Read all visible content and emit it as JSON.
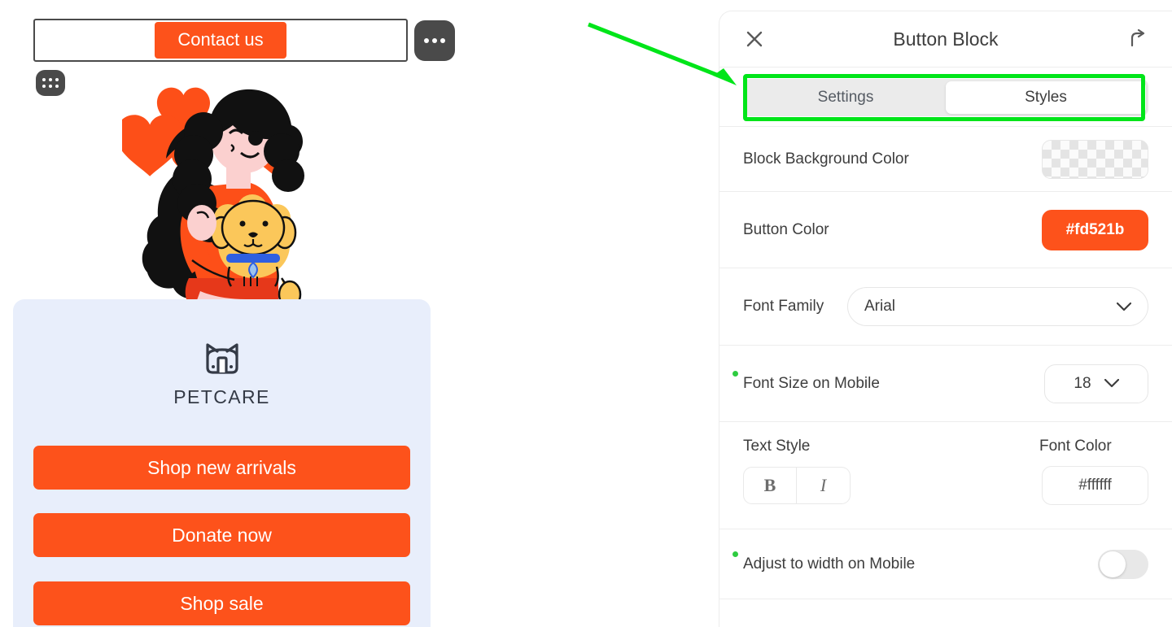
{
  "canvas": {
    "selected_block": {
      "cta_label": "Contact us",
      "more_icon": "ellipsis-icon",
      "drag_icon": "drag-grid-icon"
    },
    "illustration": {
      "alt": "woman holding a dog with hearts",
      "hair_color": "#111111",
      "shirt_color": "#fd4f18",
      "skin_color": "#fbd0cf",
      "dog_color": "#fbc75a",
      "heart_color": "#fd4f18",
      "collar_color": "#2f5fe0"
    },
    "pet_card": {
      "background": "#e8eefb",
      "logo_icon": "cat-face-icon",
      "logo_text": "PETCARE",
      "buttons": [
        {
          "label": "Shop new arrivals"
        },
        {
          "label": "Donate now"
        },
        {
          "label": "Shop sale"
        }
      ],
      "button_color": "#fd521b"
    }
  },
  "panel": {
    "title": "Button Block",
    "close_icon": "close-icon",
    "expand_icon": "arrow-up-right-curve-icon",
    "tabs": [
      {
        "label": "Settings",
        "active": false
      },
      {
        "label": "Styles",
        "active": true
      }
    ],
    "rows": {
      "block_background": {
        "label": "Block Background Color",
        "value": "transparent"
      },
      "button_color": {
        "label": "Button Color",
        "value": "#fd521b"
      },
      "font_family": {
        "label": "Font Family",
        "value": "Arial",
        "chevron_icon": "chevron-down-icon"
      },
      "font_size_mobile": {
        "label": "Font Size on Mobile",
        "value": "18",
        "chevron_icon": "chevron-down-icon",
        "indicator": "mobile-override-dot"
      },
      "text_style": {
        "label": "Text Style",
        "bold_label": "B",
        "italic_label": "I",
        "bold_active": false,
        "italic_active": false
      },
      "font_color": {
        "label": "Font Color",
        "value": "#ffffff"
      },
      "adjust_width_mobile": {
        "label": "Adjust to width on Mobile",
        "enabled": false,
        "indicator": "mobile-override-dot"
      }
    }
  },
  "annotation": {
    "arrow_color": "#00e519",
    "highlight_color": "#00e519",
    "highlight_target": "tabs"
  }
}
